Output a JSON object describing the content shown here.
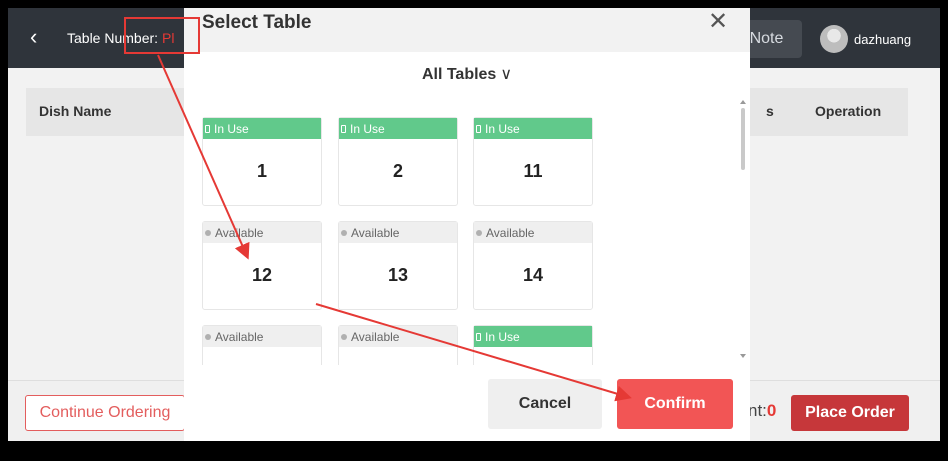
{
  "topbar": {
    "back_icon": "chevron-left-icon",
    "table_number_label": "Table Number:",
    "table_number_value": "Pl",
    "note_label": "Note",
    "username": "dazhuang"
  },
  "table_header": {
    "dish_name": "Dish Name",
    "col_partial": "s",
    "operation": "Operation"
  },
  "bottombar": {
    "continue_label": "Continue Ordering",
    "amount_label": "nt:",
    "amount_value": "0",
    "place_order_label": "Place Order"
  },
  "modal": {
    "title": "Select Table",
    "close_icon": "close-icon",
    "filter_label": "All Tables",
    "filter_icon": "chevron-down-icon",
    "tables": [
      {
        "status": "In Use",
        "number": "1"
      },
      {
        "status": "In Use",
        "number": "2"
      },
      {
        "status": "In Use",
        "number": "11"
      },
      {
        "status": "Available",
        "number": "12"
      },
      {
        "status": "Available",
        "number": "13"
      },
      {
        "status": "Available",
        "number": "14"
      },
      {
        "status": "Available",
        "number": ""
      },
      {
        "status": "Available",
        "number": ""
      },
      {
        "status": "In Use",
        "number": ""
      }
    ],
    "cancel_label": "Cancel",
    "confirm_label": "Confirm"
  },
  "colors": {
    "in_use": "#61c98b",
    "available": "#efefef",
    "confirm": "#f25555",
    "annotation": "#e53935"
  }
}
